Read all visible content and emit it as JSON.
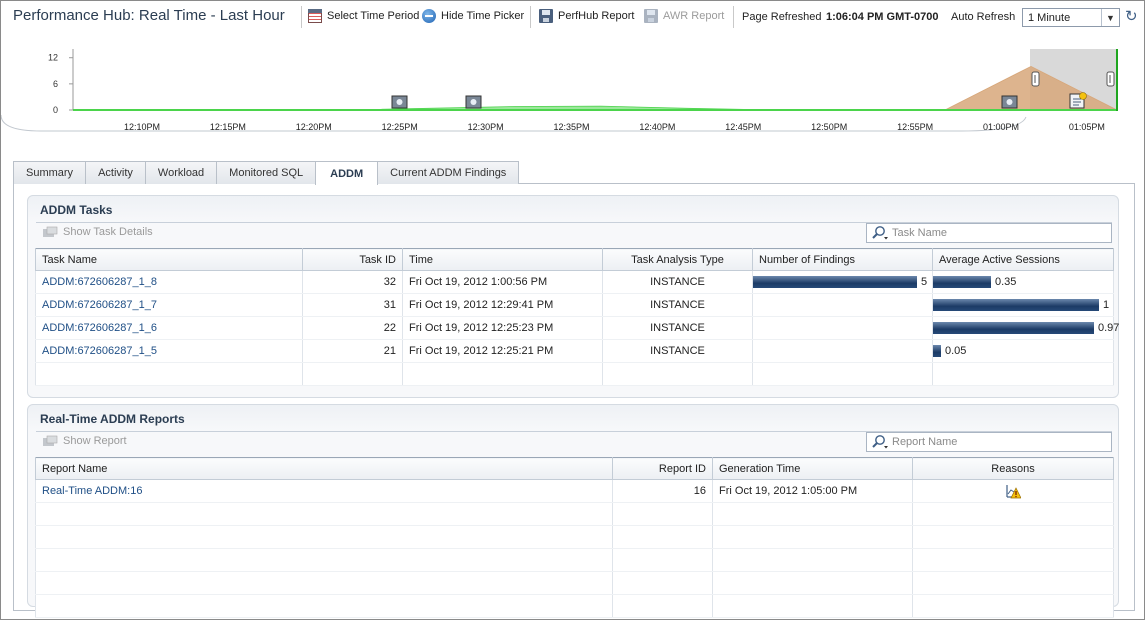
{
  "header": {
    "title": "Performance Hub: Real Time - Last Hour",
    "select_time_period": "Select Time Period",
    "hide_time_picker": "Hide Time Picker",
    "perfhub_report": "PerfHub Report",
    "awr_report": "AWR Report",
    "page_refreshed_label": "Page Refreshed",
    "page_refreshed_time": "1:06:04 PM GMT-0700",
    "auto_refresh_label": "Auto Refresh",
    "auto_refresh_value": "1 Minute"
  },
  "chart_data": {
    "type": "area",
    "y_ticks": [
      "12",
      "6",
      "0"
    ],
    "ylim": [
      0,
      14
    ],
    "x_ticks": [
      "12:10PM",
      "12:15PM",
      "12:20PM",
      "12:25PM",
      "12:30PM",
      "12:35PM",
      "12:40PM",
      "12:45PM",
      "12:50PM",
      "12:55PM",
      "01:00PM",
      "01:05PM"
    ],
    "series": [
      {
        "color": "#4bd44b",
        "values": [
          0,
          0,
          0,
          0,
          0.4,
          0.8,
          0.9,
          0.4,
          0,
          0,
          0,
          0,
          0
        ]
      },
      {
        "color": "#d7a77a",
        "values": [
          0,
          0,
          0,
          0,
          0,
          0,
          0,
          0,
          0,
          0,
          0,
          10,
          0
        ]
      }
    ],
    "grid": false,
    "legend": "none"
  },
  "tabs": [
    {
      "label": "Summary",
      "active": false
    },
    {
      "label": "Activity",
      "active": false
    },
    {
      "label": "Workload",
      "active": false
    },
    {
      "label": "Monitored SQL",
      "active": false
    },
    {
      "label": "ADDM",
      "active": true
    },
    {
      "label": "Current ADDM Findings",
      "active": false
    }
  ],
  "addm_tasks": {
    "title": "ADDM Tasks",
    "show_details": "Show Task Details",
    "search_placeholder": "Task Name",
    "columns": [
      "Task Name",
      "Task ID",
      "Time",
      "Task Analysis Type",
      "Number of Findings",
      "Average Active Sessions"
    ],
    "rows": [
      {
        "name": "ADDM:672606287_1_8",
        "id": "32",
        "time": "Fri Oct 19, 2012 1:00:56 PM",
        "type": "INSTANCE",
        "findings": "5",
        "findings_fraction": 1.0,
        "aas": "0.35",
        "aas_fraction": 0.35
      },
      {
        "name": "ADDM:672606287_1_7",
        "id": "31",
        "time": "Fri Oct 19, 2012 12:29:41 PM",
        "type": "INSTANCE",
        "findings": "",
        "findings_fraction": 0,
        "aas": "1",
        "aas_fraction": 1.0
      },
      {
        "name": "ADDM:672606287_1_6",
        "id": "22",
        "time": "Fri Oct 19, 2012 12:25:23 PM",
        "type": "INSTANCE",
        "findings": "",
        "findings_fraction": 0,
        "aas": "0.97",
        "aas_fraction": 0.97
      },
      {
        "name": "ADDM:672606287_1_5",
        "id": "21",
        "time": "Fri Oct 19, 2012 12:25:21 PM",
        "type": "INSTANCE",
        "findings": "",
        "findings_fraction": 0,
        "aas": "0.05",
        "aas_fraction": 0.05
      }
    ]
  },
  "rt_reports": {
    "title": "Real-Time ADDM Reports",
    "show_report": "Show Report",
    "search_placeholder": "Report Name",
    "columns": [
      "Report Name",
      "Report ID",
      "Generation Time",
      "Reasons"
    ],
    "rows": [
      {
        "name": "Real-Time ADDM:16",
        "id": "16",
        "time": "Fri Oct 19, 2012 1:05:00 PM",
        "reason_icon": "warning-chart-icon"
      }
    ]
  },
  "colors": {
    "title": "#2b3d52",
    "link": "#1f4f86",
    "bar": "#1c3b66",
    "green_series": "#4bd44b",
    "orange_series": "#d7a77a"
  }
}
